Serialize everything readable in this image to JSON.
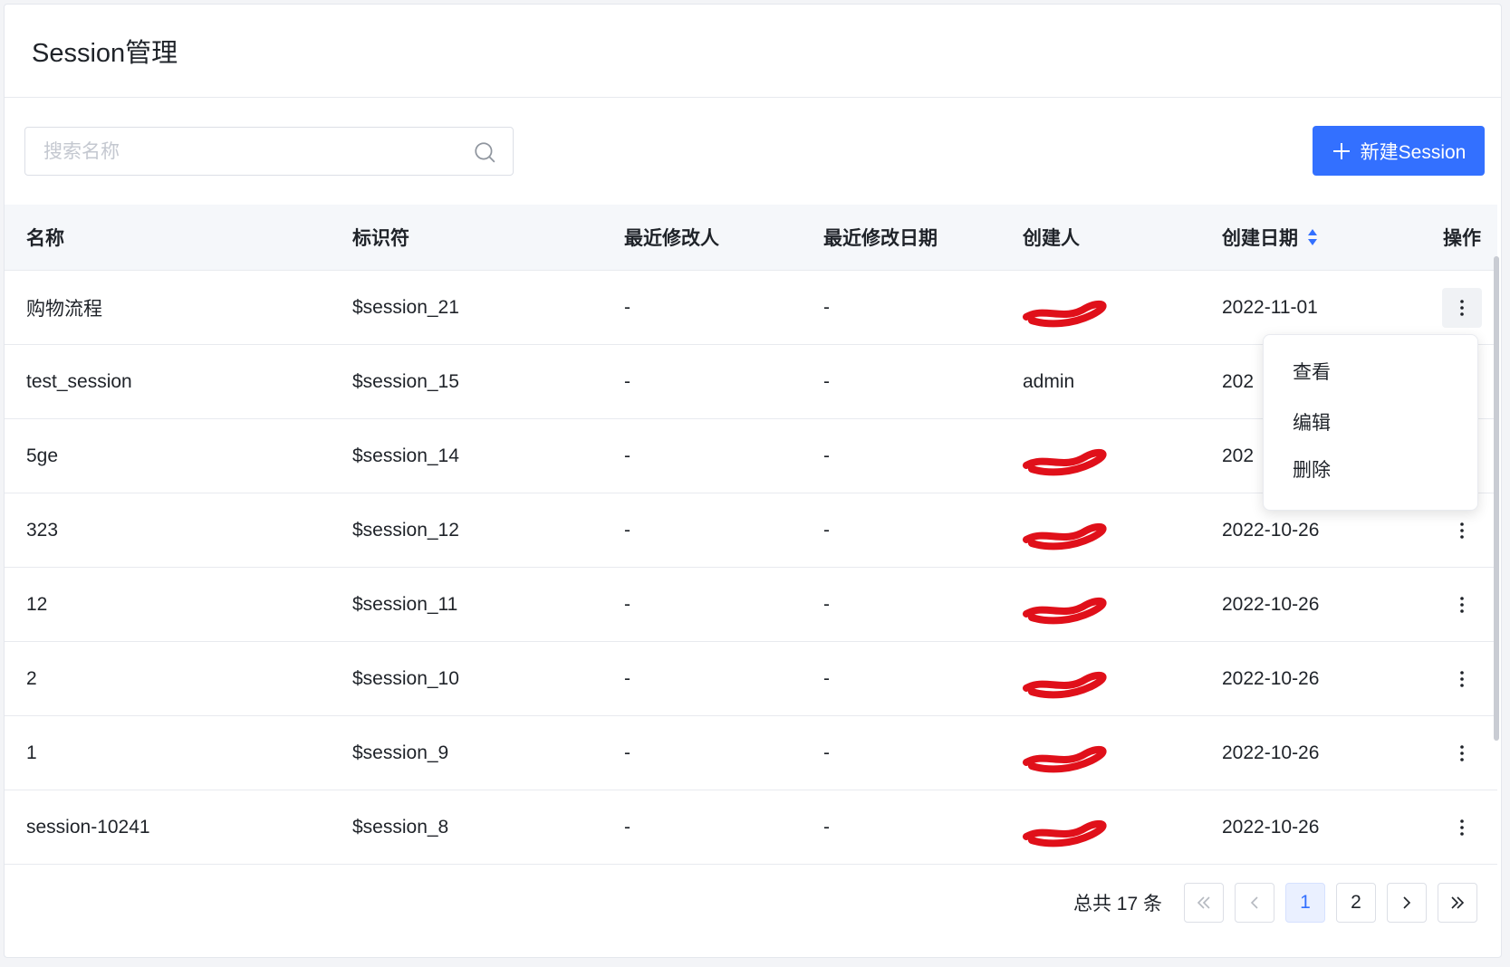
{
  "page": {
    "title": "Session管理"
  },
  "toolbar": {
    "search_placeholder": "搜索名称",
    "search_icon": "search-icon",
    "new_button_label": "新建Session",
    "new_button_icon": "plus-icon",
    "accent_color": "#3370ff"
  },
  "table": {
    "columns": [
      "名称",
      "标识符",
      "最近修改人",
      "最近修改日期",
      "创建人",
      "创建日期",
      "操作"
    ],
    "sort": {
      "column": "创建日期",
      "icon": "sort-icon"
    },
    "rows": [
      {
        "name": "购物流程",
        "identifier": "$session_21",
        "modifier": "-",
        "modified_date": "-",
        "creator": "",
        "creator_redacted": true,
        "created_date": "2022-11-01"
      },
      {
        "name": "test_session",
        "identifier": "$session_15",
        "modifier": "-",
        "modified_date": "-",
        "creator": "admin",
        "creator_redacted": false,
        "created_date": "202"
      },
      {
        "name": "5ge",
        "identifier": "$session_14",
        "modifier": "-",
        "modified_date": "-",
        "creator": "",
        "creator_redacted": true,
        "created_date": "202"
      },
      {
        "name": "323",
        "identifier": "$session_12",
        "modifier": "-",
        "modified_date": "-",
        "creator": "",
        "creator_redacted": true,
        "created_date": "2022-10-26"
      },
      {
        "name": "12",
        "identifier": "$session_11",
        "modifier": "-",
        "modified_date": "-",
        "creator": "",
        "creator_redacted": true,
        "created_date": "2022-10-26"
      },
      {
        "name": "2",
        "identifier": "$session_10",
        "modifier": "-",
        "modified_date": "-",
        "creator": "",
        "creator_redacted": true,
        "created_date": "2022-10-26"
      },
      {
        "name": "1",
        "identifier": "$session_9",
        "modifier": "-",
        "modified_date": "-",
        "creator": "",
        "creator_redacted": true,
        "created_date": "2022-10-26"
      },
      {
        "name": "session-10241",
        "identifier": "$session_8",
        "modifier": "-",
        "modified_date": "-",
        "creator": "",
        "creator_redacted": true,
        "created_date": "2022-10-26"
      }
    ]
  },
  "dropdown": {
    "open_for_row": 0,
    "items": [
      "查看",
      "编辑",
      "删除"
    ]
  },
  "pagination": {
    "total_text": "总共 17 条",
    "pages": [
      "1",
      "2"
    ],
    "current_page": "1",
    "icons": [
      "first-page-icon",
      "prev-page-icon",
      "next-page-icon",
      "last-page-icon"
    ]
  },
  "colors": {
    "redaction": "#e0101a",
    "header_bg": "#f5f7fa"
  }
}
